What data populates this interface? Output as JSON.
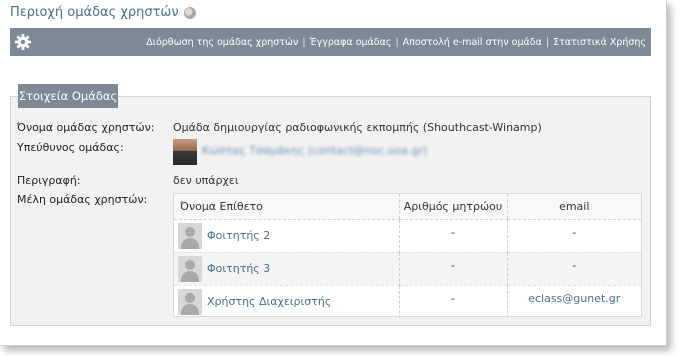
{
  "page": {
    "title": "Περιοχή ομάδας χρηστών",
    "title_icon": "help-circle-icon"
  },
  "toolbar": {
    "settings_icon": "gear-icon",
    "links": [
      "Διόρθωση της ομάδας χρηστών",
      "Έγγραφα ομάδας",
      "Αποστολή e-mail στην ομάδα",
      "Στατιστικά Χρήσης"
    ]
  },
  "panel": {
    "legend": "Στοιχεία Ομάδας",
    "name_label": "Όνομα ομάδας χρηστών:",
    "name_value": "Ομάδα δημιουργίας ραδιοφωνικής εκπομπής (Shouthcast-Winamp)",
    "owner_label": "Υπεύθυνος ομάδας:",
    "owner_name": "Κώστας Τσαμάκης (contact@noc.uoa.gr)",
    "description_label": "Περιγραφή:",
    "description_value": "δεν υπάρχει",
    "members_label": "Μέλη ομάδας χρηστών:"
  },
  "members": {
    "columns": [
      "Όνομα Επίθετο",
      "Αριθμός μητρώου",
      "email"
    ],
    "rows": [
      {
        "name": "Φοιτητής 2",
        "registry": "-",
        "email": "-"
      },
      {
        "name": "Φοιτητής 3",
        "registry": "-",
        "email": "-"
      },
      {
        "name": "Χρήστης Διαχειριστής",
        "registry": "-",
        "email": "eclass@gunet.gr"
      }
    ]
  },
  "colors": {
    "toolbar_bg": "#7d8a96",
    "link": "#4a6f8a",
    "panel_bg": "#f2f2f2"
  }
}
